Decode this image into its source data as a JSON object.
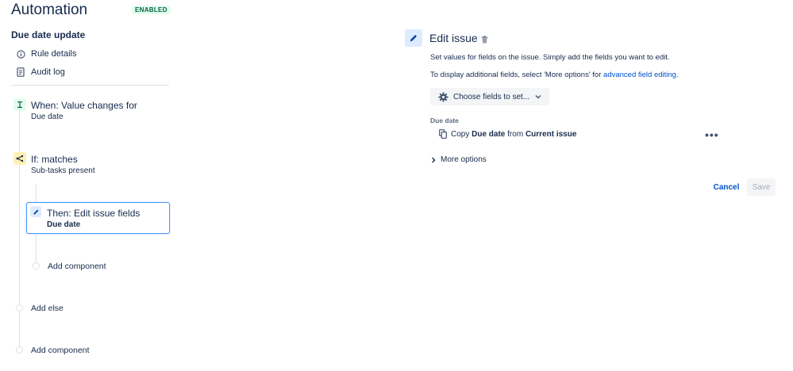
{
  "header": {
    "title": "Automation",
    "status_badge": "ENABLED",
    "rule_name": "Due date update"
  },
  "sidebar": {
    "items": [
      {
        "label": "Rule details",
        "icon": "info-icon"
      },
      {
        "label": "Audit log",
        "icon": "document-icon"
      }
    ]
  },
  "timeline": {
    "trigger": {
      "title": "When: Value changes for",
      "subtitle": "Due date",
      "icon": "trigger-icon"
    },
    "condition": {
      "title": "If: matches",
      "subtitle": "Sub-tasks present",
      "icon": "branch-icon"
    },
    "action": {
      "title": "Then: Edit issue fields",
      "subtitle": "Due date",
      "icon": "pencil-icon"
    },
    "add_component_inner": "Add component",
    "add_else": "Add else",
    "add_component_outer": "Add component"
  },
  "panel": {
    "title": "Edit issue",
    "description": "Set values for fields on the issue. Simply add the fields you want to edit.",
    "additional_prefix": "To display additional fields, select 'More options' for ",
    "additional_link": "advanced field editing",
    "additional_suffix": ".",
    "choose_fields_label": "Choose fields to set...",
    "field_label": "Due date",
    "copy_prefix": "Copy",
    "copy_field": "Due date",
    "copy_from": "from",
    "copy_source": "Current issue",
    "more_options": "More options",
    "cancel_label": "Cancel",
    "save_label": "Save"
  },
  "colors": {
    "accent": "#0052cc",
    "selected_border": "#4c9aff",
    "trigger_icon_bg": "#e3fcef",
    "condition_icon_bg": "#fff0b3",
    "action_icon_bg": "#deebff",
    "enabled_badge": "#006644"
  }
}
